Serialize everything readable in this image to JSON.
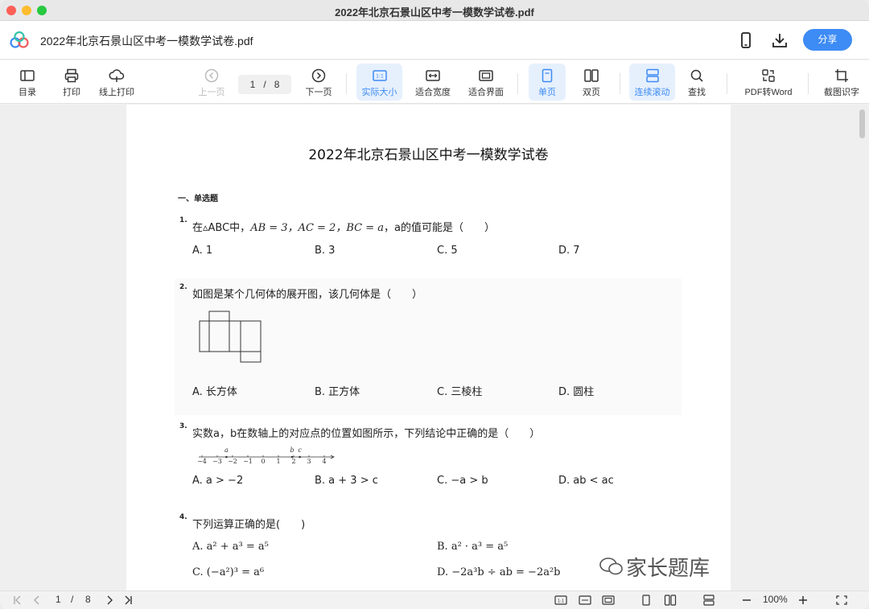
{
  "window": {
    "title": "2022年北京石景山区中考一模数学试卷.pdf"
  },
  "header": {
    "doc_title": "2022年北京石景山区中考一模数学试卷.pdf",
    "share_label": "分享"
  },
  "toolbar": {
    "toc": "目录",
    "print": "打印",
    "online_print": "线上打印",
    "prev": "上一页",
    "page_current": "1",
    "page_sep": "/",
    "page_total": "8",
    "next": "下一页",
    "actual_size": "实际大小",
    "actual_size_badge": "1:1",
    "fit_width": "适合宽度",
    "fit_page": "适合界面",
    "single": "单页",
    "double": "双页",
    "continuous": "连续滚动",
    "find": "查找",
    "pdf_to_word": "PDF转Word",
    "ocr": "截图识字"
  },
  "paper": {
    "title": "2022年北京石景山区中考一模数学试卷",
    "section": "一、单选题",
    "questions": [
      {
        "num": "1.",
        "text_pre": "在▵ABC中，",
        "text_math": "AB = 3，AC = 2，BC = a",
        "text_post": "，a的值可能是（　　）",
        "options": [
          "A. 1",
          "B. 3",
          "C. 5",
          "D. 7"
        ]
      },
      {
        "num": "2.",
        "text": "如图是某个几何体的展开图，该几何体是（　　）",
        "options": [
          "A. 长方体",
          "B. 正方体",
          "C. 三棱柱",
          "D. 圆柱"
        ]
      },
      {
        "num": "3.",
        "text": "实数a，b在数轴上的对应点的位置如图所示，下列结论中正确的是（　　）",
        "numberline_ticks": [
          "−4",
          "−3",
          "−2",
          "−1",
          "0",
          "1",
          "2",
          "3",
          "4"
        ],
        "numberline_points": [
          "a",
          "b",
          "c"
        ],
        "options": [
          "A. a > −2",
          "B. a + 3 > c",
          "C. −a > b",
          "D. ab < ac"
        ]
      },
      {
        "num": "4.",
        "text": "下列运算正确的是(　　)",
        "options": [
          "A. a² + a³ = a⁵",
          "B. a² · a³ = a⁵",
          "C. (−a²)³ = a⁶",
          "D. −2a³b ÷ ab = −2a²b"
        ]
      }
    ]
  },
  "watermark": "家长题库",
  "statusbar": {
    "page_current": "1",
    "page_sep": "/",
    "page_total": "8",
    "zoom": "100%",
    "actual_badge": "1:1"
  }
}
